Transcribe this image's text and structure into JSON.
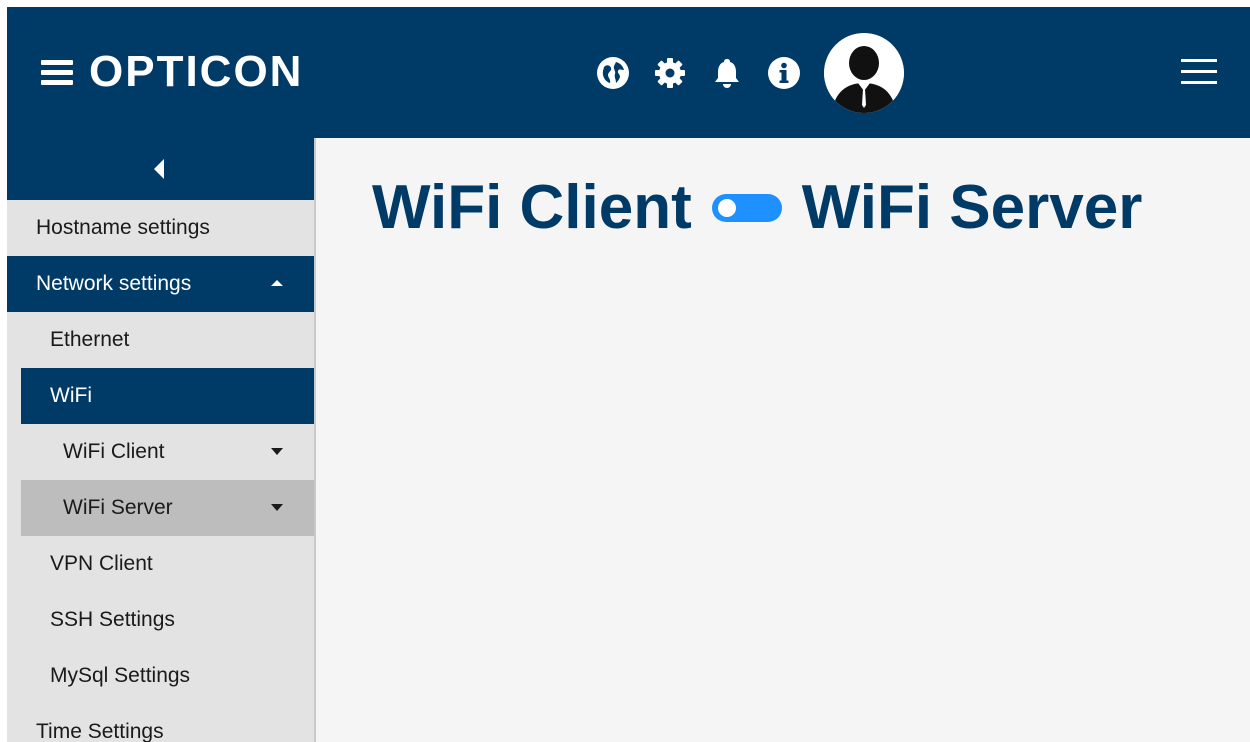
{
  "header": {
    "brand": "OPTICON",
    "icons": [
      "globe-icon",
      "gear-icon",
      "bell-icon",
      "info-icon"
    ],
    "avatar": "user-avatar",
    "colors": {
      "bar": "#003a66",
      "text": "#ffffff"
    }
  },
  "sidebar": {
    "items": [
      {
        "label": "Hostname settings"
      },
      {
        "label": "Network settings"
      },
      {
        "label": "Ethernet"
      },
      {
        "label": "WiFi"
      },
      {
        "label": "WiFi Client"
      },
      {
        "label": "WiFi Server"
      },
      {
        "label": "VPN Client"
      },
      {
        "label": "SSH Settings"
      },
      {
        "label": "MySql Settings"
      },
      {
        "label": "Time Settings"
      }
    ],
    "colors": {
      "active": "#003a66",
      "selected": "#bdbdbd",
      "background": "#e3e3e3"
    }
  },
  "main": {
    "left_label": "WiFi Client",
    "right_label": "WiFi Server",
    "toggle_on": true,
    "colors": {
      "title": "#003a66",
      "toggle": "#1e90ff"
    }
  }
}
